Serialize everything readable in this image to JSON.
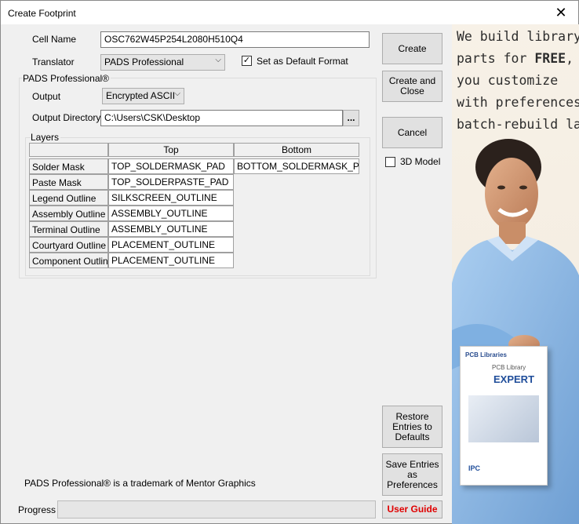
{
  "window": {
    "title": "Create Footprint"
  },
  "form": {
    "cell_name_label": "Cell Name",
    "cell_name_value": "OSC762W45P254L2080H510Q4",
    "translator_label": "Translator",
    "translator_value": "PADS Professional",
    "default_format_label": "Set as Default Format",
    "default_format_checked": true
  },
  "pads": {
    "group_label": "PADS Professional®",
    "output_label": "Output",
    "output_value": "Encrypted ASCII",
    "output_dir_label": "Output Directory",
    "output_dir_value": "C:\\Users\\CSK\\Desktop",
    "browse_label": "...",
    "layers_label": "Layers",
    "columns": [
      "Top",
      "Bottom"
    ],
    "rows": [
      {
        "name": "Solder Mask",
        "top": "TOP_SOLDERMASK_PAD",
        "bottom": "BOTTOM_SOLDERMASK_PAD"
      },
      {
        "name": "Paste Mask",
        "top": "TOP_SOLDERPASTE_PAD",
        "bottom": ""
      },
      {
        "name": "Legend Outline",
        "top": "SILKSCREEN_OUTLINE",
        "bottom": ""
      },
      {
        "name": "Assembly Outline",
        "top": "ASSEMBLY_OUTLINE",
        "bottom": ""
      },
      {
        "name": "Terminal Outline",
        "top": "ASSEMBLY_OUTLINE",
        "bottom": ""
      },
      {
        "name": "Courtyard Outline",
        "top": "PLACEMENT_OUTLINE",
        "bottom": ""
      },
      {
        "name": "Component Outline",
        "top": "PLACEMENT_OUTLINE",
        "bottom": ""
      }
    ],
    "trademark": "PADS Professional® is a trademark of Mentor Graphics"
  },
  "buttons": {
    "create": "Create",
    "create_close_1": "Create and",
    "create_close_2": "Close",
    "cancel": "Cancel",
    "model3d_label": "3D Model",
    "restore_1": "Restore",
    "restore_2": "Entries to",
    "restore_3": "Defaults",
    "save_1": "Save Entries",
    "save_2": "as",
    "save_3": "Preferences",
    "user_guide": "User Guide"
  },
  "progress": {
    "label": "Progress",
    "value": 0
  },
  "ad": {
    "line1": "We build library",
    "line2a": "parts for ",
    "line2b": "FREE",
    "line2c": ",",
    "line3": "you customize",
    "line4": "with preferences &",
    "line5": "batch-rebuild later!",
    "box_brand": "PCB Libraries",
    "box_product_1": "PCB Library",
    "box_product_2": "EXPERT",
    "box_badge": "IPC"
  },
  "colors": {
    "user_guide_text": "#e00000",
    "shirt": "#8fb9e6"
  }
}
